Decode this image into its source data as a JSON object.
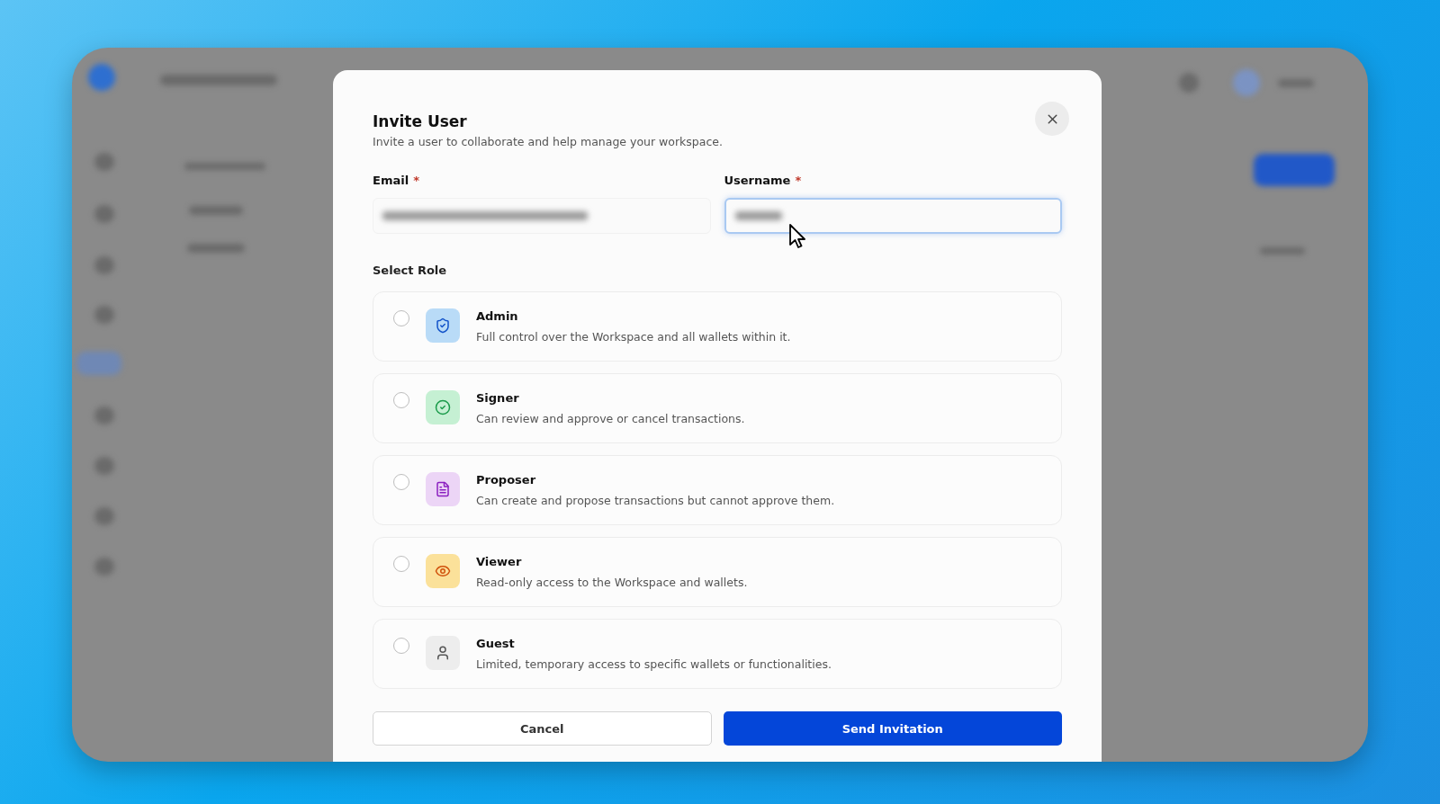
{
  "dialog": {
    "title": "Invite User",
    "subtitle": "Invite a user to collaborate and help manage your workspace.",
    "fields": [
      {
        "label": "Email",
        "required_mark": "*",
        "focused": false
      },
      {
        "label": "Username",
        "required_mark": "*",
        "focused": true
      }
    ],
    "role_label": "Select Role",
    "roles": [
      {
        "kind": "admin",
        "name": "Admin",
        "description": "Full control over the Workspace and all wallets within it.",
        "selected": false
      },
      {
        "kind": "signer",
        "name": "Signer",
        "description": "Can review and approve or cancel transactions.",
        "selected": false
      },
      {
        "kind": "proposer",
        "name": "Proposer",
        "description": "Can create and propose transactions but cannot approve them.",
        "selected": false
      },
      {
        "kind": "viewer",
        "name": "Viewer",
        "description": "Read-only access to the Workspace and wallets.",
        "selected": false
      },
      {
        "kind": "guest",
        "name": "Guest",
        "description": "Limited, temporary access to specific wallets or functionalities.",
        "selected": false
      }
    ],
    "buttons": [
      {
        "kind": "secondary",
        "label": "Cancel"
      },
      {
        "kind": "primary",
        "label": "Send Invitation"
      }
    ]
  }
}
